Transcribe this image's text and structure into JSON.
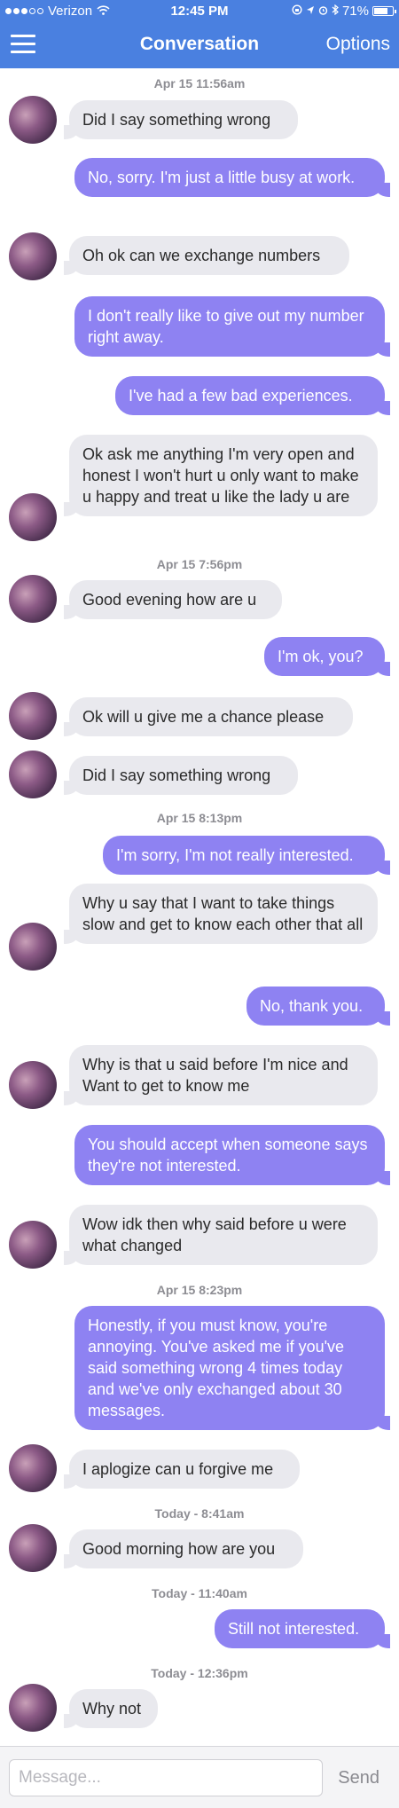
{
  "status_bar": {
    "carrier": "Verizon",
    "time": "12:45 PM",
    "battery": "71%"
  },
  "nav": {
    "title": "Conversation",
    "options_label": "Options"
  },
  "timestamps": [
    "Apr 15 11:56am",
    "Apr 15 7:56pm",
    "Apr 15 8:13pm",
    "Apr 15 8:23pm",
    "Today - 8:41am",
    "Today - 11:40am",
    "Today - 12:36pm"
  ],
  "messages": [
    "Did I say something wrong",
    "No, sorry. I'm just a little busy at work.",
    "Oh ok can we exchange numbers",
    "I don't really like to give out my number right away.",
    "I've had a few bad experiences.",
    "Ok ask me anything I'm very open and honest I won't hurt u only want to make u happy and treat u like the lady u are",
    "Good evening how are u",
    "I'm ok, you?",
    "Ok will u give me a chance please",
    "Did I say something wrong",
    "I'm sorry, I'm not really interested.",
    "Why u say that I want to take things slow and get to know each other that all",
    "No, thank you.",
    "Why is that u said before I'm nice and Want to get to know me",
    "You should accept when someone says they're not interested.",
    "Wow idk then why said before u were what changed",
    "Honestly, if you must know, you're annoying. You've asked me if you've said something wrong 4 times today and we've only exchanged about 30 messages.",
    "I aplogize can u forgive me",
    "Good morning how are you",
    "Still not interested.",
    "Why not"
  ],
  "composer": {
    "placeholder": "Message...",
    "send_label": "Send"
  }
}
